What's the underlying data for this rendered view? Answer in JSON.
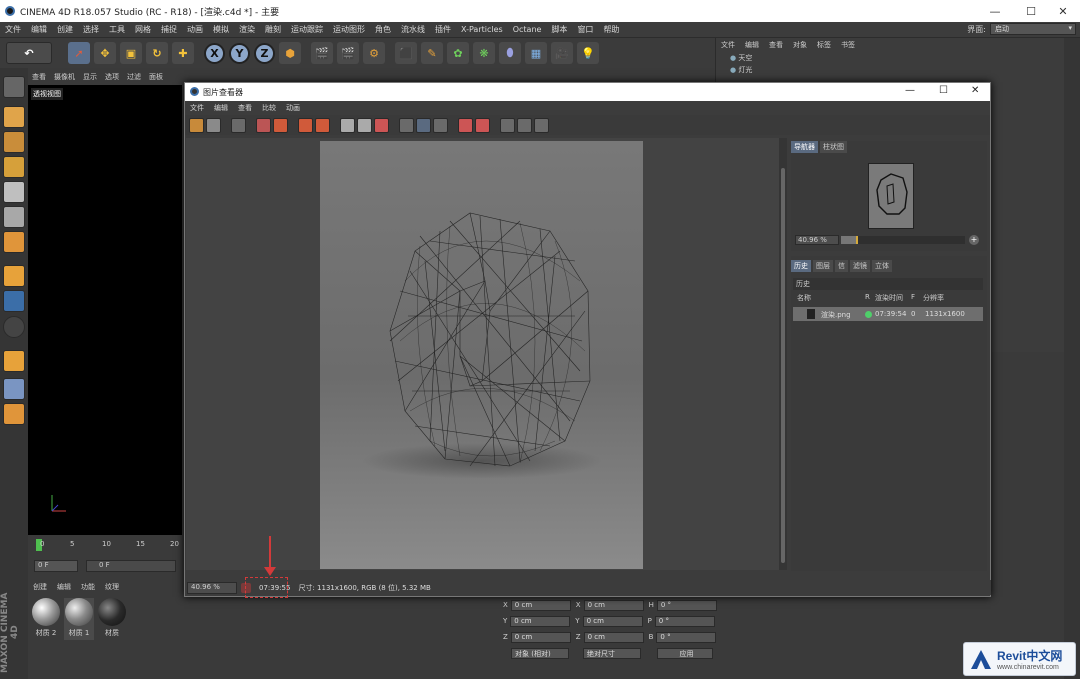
{
  "window": {
    "title": "CINEMA 4D R18.057 Studio (RC - R18) - [渲染.c4d *] - 主要",
    "controls": [
      "—",
      "☐",
      "✕"
    ]
  },
  "menu": [
    "文件",
    "编辑",
    "创建",
    "选择",
    "工具",
    "网格",
    "捕捉",
    "动画",
    "模拟",
    "渲染",
    "雕刻",
    "运动跟踪",
    "运动图形",
    "角色",
    "流水线",
    "插件",
    "X-Particles",
    "Octane",
    "脚本",
    "窗口",
    "帮助"
  ],
  "interface": {
    "label": "界面:",
    "value": "启动"
  },
  "viewport": {
    "menu": [
      "查看",
      "摄像机",
      "显示",
      "选项",
      "过滤",
      "面板"
    ],
    "label": "透视视图",
    "timeline": [
      "0",
      "5",
      "10",
      "15",
      "20"
    ],
    "frame_start": "0 F",
    "frame_range": "0 F"
  },
  "materials": {
    "menu": [
      "创建",
      "编辑",
      "功能",
      "纹理"
    ],
    "items": [
      "材质 2",
      "材质 1",
      "材质"
    ]
  },
  "coordinates": {
    "rows": [
      {
        "a": "X",
        "av": "0 cm",
        "b": "X",
        "bv": "0 cm",
        "c": "H",
        "cv": "0 °"
      },
      {
        "a": "Y",
        "av": "0 cm",
        "b": "Y",
        "bv": "0 cm",
        "c": "P",
        "cv": "0 °"
      },
      {
        "a": "Z",
        "av": "0 cm",
        "b": "Z",
        "bv": "0 cm",
        "c": "B",
        "cv": "0 °"
      }
    ],
    "mode_select": "对象 (相对)",
    "size_select": "绝对尺寸",
    "apply": "应用"
  },
  "object_manager": {
    "menu": [
      "文件",
      "编辑",
      "查看",
      "对象",
      "标签",
      "书签"
    ],
    "items": [
      "天空",
      "灯光"
    ]
  },
  "picture_viewer": {
    "title": "图片查看器",
    "menu": [
      "文件",
      "编辑",
      "查看",
      "比较",
      "动画"
    ],
    "nav_tabs": [
      "导航器",
      "柱状图"
    ],
    "zoom": "40.96 %",
    "zoom_fill": 0.14,
    "hist_tabs": [
      "历史",
      "图层",
      "信",
      "滤镜",
      "立体"
    ],
    "history_label": "历史",
    "columns": {
      "name": "名称",
      "r": "R",
      "time": "渲染时间",
      "f": "F",
      "res": "分辨率"
    },
    "row": {
      "name": "渲染.png",
      "time": "07:39:54",
      "f": "0",
      "res": "1131x1600"
    },
    "status_zoom": "40.96 %",
    "status_time": "07:39:55",
    "status_info": "尺寸: 1131x1600, RGB (8 位), 5.32 MB"
  },
  "sidebar": {
    "maxon_label": "MAXON CINEMA 4D"
  },
  "watermark": {
    "brand": "Revit中文网",
    "url": "www.chinarevit.com"
  }
}
